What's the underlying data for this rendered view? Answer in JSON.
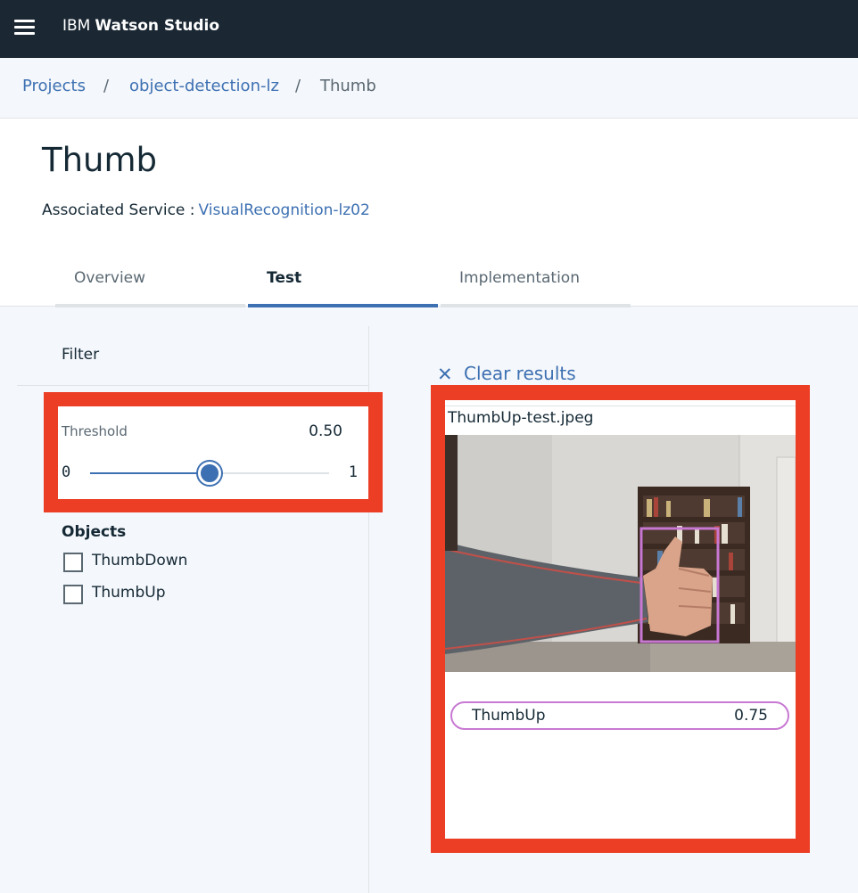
{
  "app": {
    "brand_prefix": "IBM",
    "brand_name": "Watson Studio"
  },
  "breadcrumb": {
    "items": [
      "Projects",
      "object-detection-lz",
      "Thumb"
    ],
    "separator": "/"
  },
  "page": {
    "title": "Thumb",
    "service_label": "Associated Service :",
    "service_name": "VisualRecognition-lz02"
  },
  "tabs": [
    {
      "label": "Overview",
      "active": false
    },
    {
      "label": "Test",
      "active": true
    },
    {
      "label": "Implementation",
      "active": false
    }
  ],
  "filter": {
    "title": "Filter",
    "threshold_label": "Threshold",
    "threshold_value": "0.50",
    "threshold_fraction": 0.5,
    "slider_min": "0",
    "slider_max": "1",
    "objects_title": "Objects",
    "objects": [
      {
        "label": "ThumbDown",
        "checked": false
      },
      {
        "label": "ThumbUp",
        "checked": false
      }
    ]
  },
  "results": {
    "clear_label": "Clear results",
    "file_name": "ThumbUp-test.jpeg",
    "detections": [
      {
        "label": "ThumbUp",
        "score": "0.75"
      }
    ]
  },
  "colors": {
    "topbar": "#1b2834",
    "link": "#3d70b2",
    "highlight_frame": "#ec3d25",
    "detection_box": "#c878d2"
  },
  "icons": {
    "menu": "hamburger-menu-icon",
    "clear": "close-icon"
  }
}
